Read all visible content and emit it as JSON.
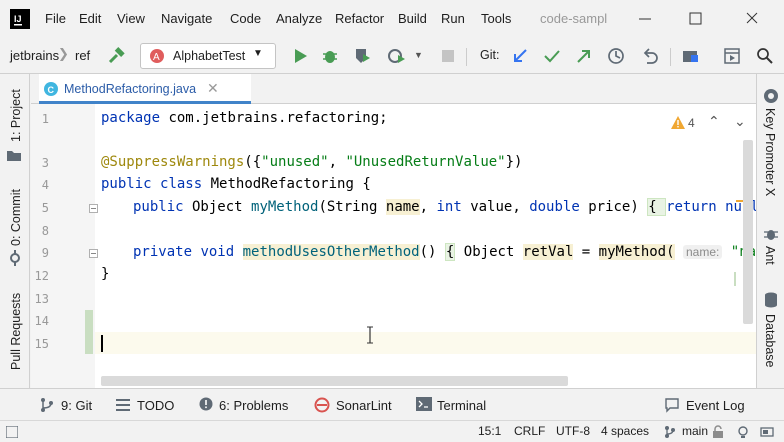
{
  "menu": {
    "items": [
      "File",
      "Edit",
      "View",
      "Navigate",
      "Code",
      "Analyze",
      "Refactor",
      "Build",
      "Run",
      "Tools"
    ],
    "project_title": "code-sampl"
  },
  "navbar": {
    "breadcrumbs": [
      "jetbrains",
      "ref"
    ],
    "run_config": "AlphabetTest",
    "git_label": "Git:"
  },
  "left_strip": {
    "project": "1: Project",
    "commit": "0: Commit",
    "pull_requests": "Pull Requests"
  },
  "right_strip": {
    "key_promoter": "Key Promoter X",
    "ant": "Ant",
    "database": "Database"
  },
  "tab": {
    "filename": "MethodRefactoring.java"
  },
  "editor": {
    "warning_count": "4",
    "line_numbers": [
      "1",
      "3",
      "4",
      "5",
      "8",
      "9",
      "12",
      "13",
      "14",
      "15"
    ],
    "lines": {
      "l1_kw": "package",
      "l1_rest": " com.jetbrains.refactoring;",
      "l3_ann": "@SuppressWarnings",
      "l3_a": "({",
      "l3_s1": "\"unused\"",
      "l3_b": ", ",
      "l3_s2": "\"UnusedReturnValue\"",
      "l3_c": "})",
      "l4_kw1": "public",
      "l4_kw2": "class",
      "l4_rest": " MethodRefactoring {",
      "l5_kw1": "public",
      "l5_a": " Object ",
      "l5_fn": "myMethod",
      "l5_b": "(String ",
      "l5_p1": "name",
      "l5_c": ", ",
      "l5_kw2": "int",
      "l5_d": " value, ",
      "l5_kw3": "double",
      "l5_e": " price) ",
      "l5_fold": "{ ",
      "l5_kw4": "return",
      "l5_sp": " ",
      "l5_kw5": "null",
      "l5_f": "; }",
      "l9_kw1": "private",
      "l9_kw2": "void",
      "l9_fn": "methodUsesOtherMethod",
      "l9_a": "() ",
      "l9_fold": "{",
      "l9_b": " Object ",
      "l9_var": "retVal",
      "l9_c": " = ",
      "l9_call": "myMethod(",
      "l9_hint": "name:",
      "l9_str": "\"name\",",
      "l12": "}"
    }
  },
  "bottom_tabs": {
    "git": "9: Git",
    "todo": "TODO",
    "problems": "6: Problems",
    "sonarlint": "SonarLint",
    "terminal": "Terminal",
    "event_log": "Event Log"
  },
  "status": {
    "position": "15:1",
    "line_sep": "CRLF",
    "encoding": "UTF-8",
    "indent": "4 spaces",
    "branch": "main"
  },
  "colors": {
    "accent": "#4083c9",
    "run_green": "#499c54",
    "keyword": "#0033b3",
    "string": "#067d17"
  }
}
